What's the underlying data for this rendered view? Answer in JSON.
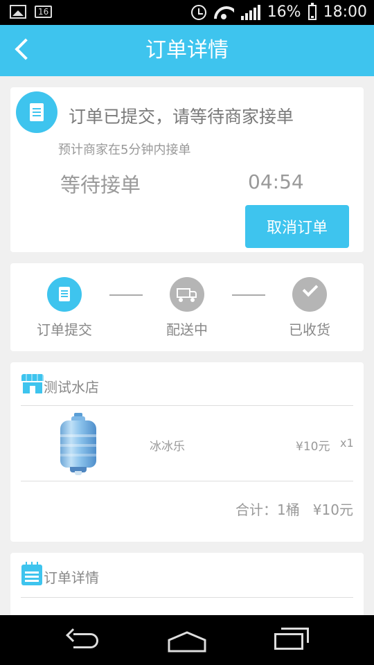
{
  "status_bar": {
    "notification_badge": "16",
    "battery": "16%",
    "time": "18:00"
  },
  "header": {
    "title": "订单详情"
  },
  "order_status": {
    "title": "订单已提交，请等待商家接单",
    "subtitle": "预计商家在5分钟内接单",
    "state_label": "等待接单",
    "countdown": "04:54",
    "cancel_label": "取消订单"
  },
  "progress": {
    "steps": [
      {
        "label": "订单提交",
        "active": true
      },
      {
        "label": "配送中",
        "active": false
      },
      {
        "label": "已收货",
        "active": false
      }
    ]
  },
  "shop": {
    "name": "测试水店",
    "items": [
      {
        "name": "冰冰乐",
        "price": "¥10元",
        "qty": "x1"
      }
    ],
    "total": "合计：1桶   ¥10元"
  },
  "details": {
    "title": "订单详情"
  },
  "colors": {
    "accent": "#3ec4ee",
    "inactive": "#b5b5b5"
  }
}
